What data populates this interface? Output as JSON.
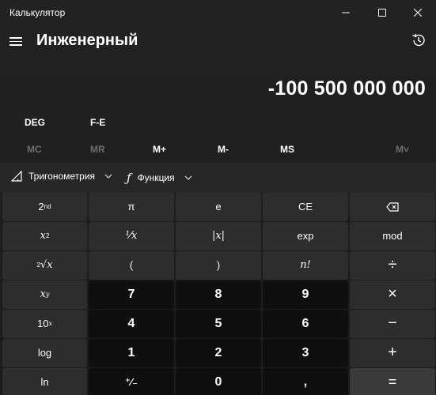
{
  "window": {
    "title": "Калькулятор",
    "controls": {
      "minimize": "—",
      "maximize": "☐",
      "close": "✕"
    }
  },
  "header": {
    "mode_title": "Инженерный",
    "history_icon": "history-icon"
  },
  "display": {
    "value": "-100 500 000 000"
  },
  "mode_buttons": {
    "angle": "DEG",
    "fe": "F-E"
  },
  "memory": {
    "mc": "MC",
    "mr": "MR",
    "m_plus": "M+",
    "m_minus": "M-",
    "ms": "MS",
    "m_list": "M˅"
  },
  "function_bar": {
    "trig_label": "Тригонометрия",
    "func_label": "Функция"
  },
  "keys": {
    "second": "2",
    "pi": "π",
    "e": "e",
    "ce": "CE",
    "x_squared": "x",
    "reciprocal": "⅟x",
    "abs": "|x|",
    "exp": "exp",
    "mod": "mod",
    "sqrt": "√x",
    "open_paren": "(",
    "close_paren": ")",
    "factorial": "n!",
    "divide": "÷",
    "x_pow_y": "x",
    "seven": "7",
    "eight": "8",
    "nine": "9",
    "multiply": "×",
    "ten_pow_x": "10",
    "four": "4",
    "five": "5",
    "six": "6",
    "minus": "−",
    "log": "log",
    "one": "1",
    "two": "2",
    "three": "3",
    "plus": "+",
    "ln": "ln",
    "negate": "⁺∕₋",
    "zero": "0",
    "decimal": ",",
    "equals": "="
  },
  "colors": {
    "background": "#202020",
    "function_key": "#2d2d2d",
    "number_key": "#0f0f0f",
    "equals_key": "#3a3a3a",
    "disabled_text": "#6f6f6f"
  }
}
